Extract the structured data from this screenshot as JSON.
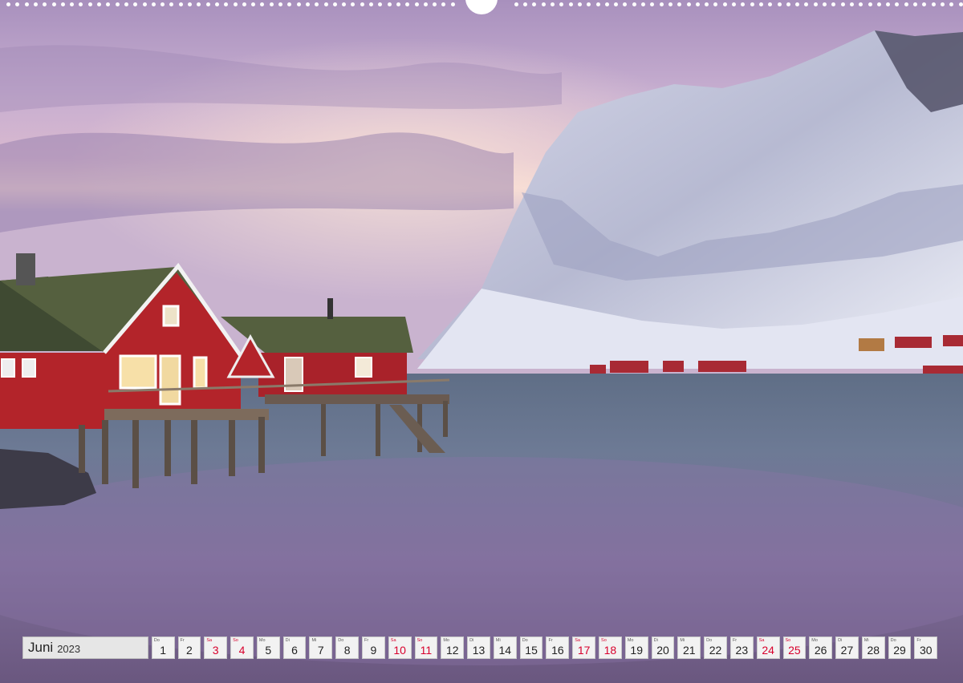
{
  "photo": {
    "subject": "Red fishermen cabins on stilts by a calm fjord at dusk, snowy mountain",
    "colors": {
      "sky": "#b89ac2",
      "water": "#6f6d8a",
      "cabin": "#b3242a",
      "snow": "#e6e8f3"
    }
  },
  "calendar": {
    "month": "Juni",
    "year": "2023",
    "days": [
      {
        "wd": "Do",
        "d": "1",
        "we": false
      },
      {
        "wd": "Fr",
        "d": "2",
        "we": false
      },
      {
        "wd": "Sa",
        "d": "3",
        "we": true
      },
      {
        "wd": "So",
        "d": "4",
        "we": true
      },
      {
        "wd": "Mo",
        "d": "5",
        "we": false
      },
      {
        "wd": "Di",
        "d": "6",
        "we": false
      },
      {
        "wd": "Mi",
        "d": "7",
        "we": false
      },
      {
        "wd": "Do",
        "d": "8",
        "we": false
      },
      {
        "wd": "Fr",
        "d": "9",
        "we": false
      },
      {
        "wd": "Sa",
        "d": "10",
        "we": true
      },
      {
        "wd": "So",
        "d": "11",
        "we": true
      },
      {
        "wd": "Mo",
        "d": "12",
        "we": false
      },
      {
        "wd": "Di",
        "d": "13",
        "we": false
      },
      {
        "wd": "Mi",
        "d": "14",
        "we": false
      },
      {
        "wd": "Do",
        "d": "15",
        "we": false
      },
      {
        "wd": "Fr",
        "d": "16",
        "we": false
      },
      {
        "wd": "Sa",
        "d": "17",
        "we": true
      },
      {
        "wd": "So",
        "d": "18",
        "we": true
      },
      {
        "wd": "Mo",
        "d": "19",
        "we": false
      },
      {
        "wd": "Di",
        "d": "20",
        "we": false
      },
      {
        "wd": "Mi",
        "d": "21",
        "we": false
      },
      {
        "wd": "Do",
        "d": "22",
        "we": false
      },
      {
        "wd": "Fr",
        "d": "23",
        "we": false
      },
      {
        "wd": "Sa",
        "d": "24",
        "we": true
      },
      {
        "wd": "So",
        "d": "25",
        "we": true
      },
      {
        "wd": "Mo",
        "d": "26",
        "we": false
      },
      {
        "wd": "Di",
        "d": "27",
        "we": false
      },
      {
        "wd": "Mi",
        "d": "28",
        "we": false
      },
      {
        "wd": "Do",
        "d": "29",
        "we": false
      },
      {
        "wd": "Fr",
        "d": "30",
        "we": false
      }
    ],
    "weekend_color": "#d8002c"
  }
}
